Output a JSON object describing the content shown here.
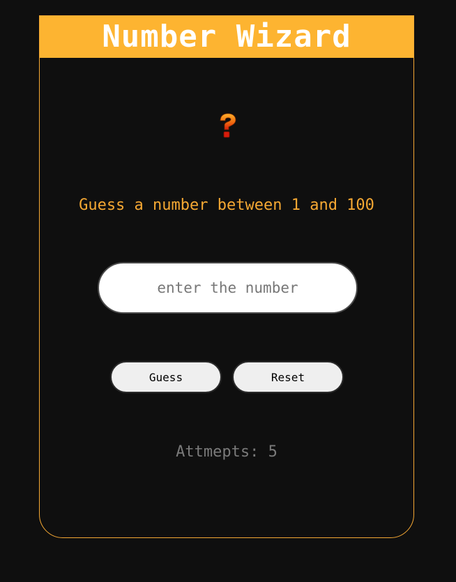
{
  "app": {
    "title": "Number Wizard"
  },
  "game": {
    "icon": "question-mark-icon",
    "prompt": "Guess a number between 1 and 100",
    "input_placeholder": "enter the number",
    "input_value": "",
    "guess_label": "Guess",
    "reset_label": "Reset",
    "attempts_text": "Attmepts: 5"
  },
  "colors": {
    "background": "#0f0f0f",
    "header": "#fdb431",
    "accent": "#f5a833",
    "attempts_text": "#7a7a7a",
    "button_bg": "#efefef"
  }
}
